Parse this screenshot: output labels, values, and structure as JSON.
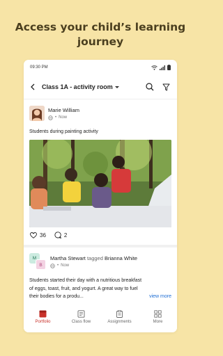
{
  "headline": {
    "line1": "Access your child’s learning",
    "line2": "journey"
  },
  "status_bar": {
    "time": "09:30 PM",
    "icons": [
      "wifi-icon",
      "signal-icon",
      "battery-icon"
    ]
  },
  "app_bar": {
    "title": "Class 1A - activity room",
    "actions": [
      "search-icon",
      "filter-icon"
    ]
  },
  "post1": {
    "author": "Marie William",
    "visibility_icon": "globe-icon",
    "time": "Now",
    "caption": "Students during painting activity",
    "likes": "36",
    "comments": "2"
  },
  "post2": {
    "author": "Martha Stewart",
    "tagged_word": "tagged",
    "tagged_person": "Brianna White",
    "avatar_initials": [
      "M",
      "B"
    ],
    "time": "Now",
    "text": "Students started their day with a nutritious breakfast of eggs, toast, fruit, and yogurt. A great way to fuel their bodies for a produ...",
    "view_more": "view more"
  },
  "tabs": [
    {
      "label": "Portfolio",
      "icon": "portfolio-icon",
      "active": true
    },
    {
      "label": "Class flow",
      "icon": "class-flow-icon",
      "active": false
    },
    {
      "label": "Assignments",
      "icon": "assignments-icon",
      "active": false
    },
    {
      "label": "More",
      "icon": "grid-icon",
      "active": false
    }
  ],
  "colors": {
    "background": "#f7e4a6",
    "accent": "#c8312a",
    "link": "#1f6ed4"
  }
}
